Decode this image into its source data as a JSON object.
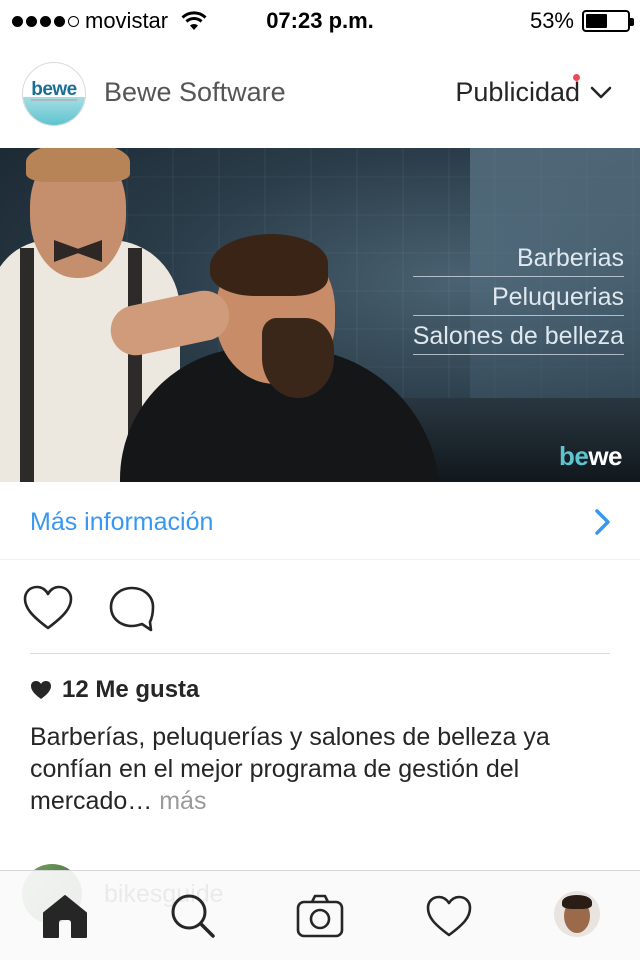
{
  "status_bar": {
    "carrier": "movistar",
    "time": "07:23 p.m.",
    "battery_percent": "53%",
    "battery_level": 0.53,
    "signal_bars_filled": 4,
    "signal_bars_total": 5
  },
  "post": {
    "account_name": "Bewe Software",
    "avatar_logo_text": "bewe",
    "sponsored_label": "Publicidad",
    "ad_image": {
      "lines": [
        "Barberias",
        "Peluquerias",
        "Salones de belleza"
      ],
      "brand_be": "be",
      "brand_we": "we"
    },
    "cta_label": "Más información",
    "likes_text": "12 Me gusta",
    "caption": "Barberías, peluquerías y salones de belleza ya confían en el mejor programa de gestión del mercado…",
    "caption_more": "más"
  },
  "next_post": {
    "account_name": "bikesguide"
  },
  "icons": {
    "like": "heart-outline-icon",
    "comment": "comment-bubble-icon",
    "home": "home-icon",
    "search": "search-icon",
    "camera": "camera-icon",
    "activity": "heart-activity-icon"
  },
  "colors": {
    "link_blue": "#3897f0",
    "notification_red": "#ed4956",
    "brand_teal": "#5ec4cf"
  }
}
